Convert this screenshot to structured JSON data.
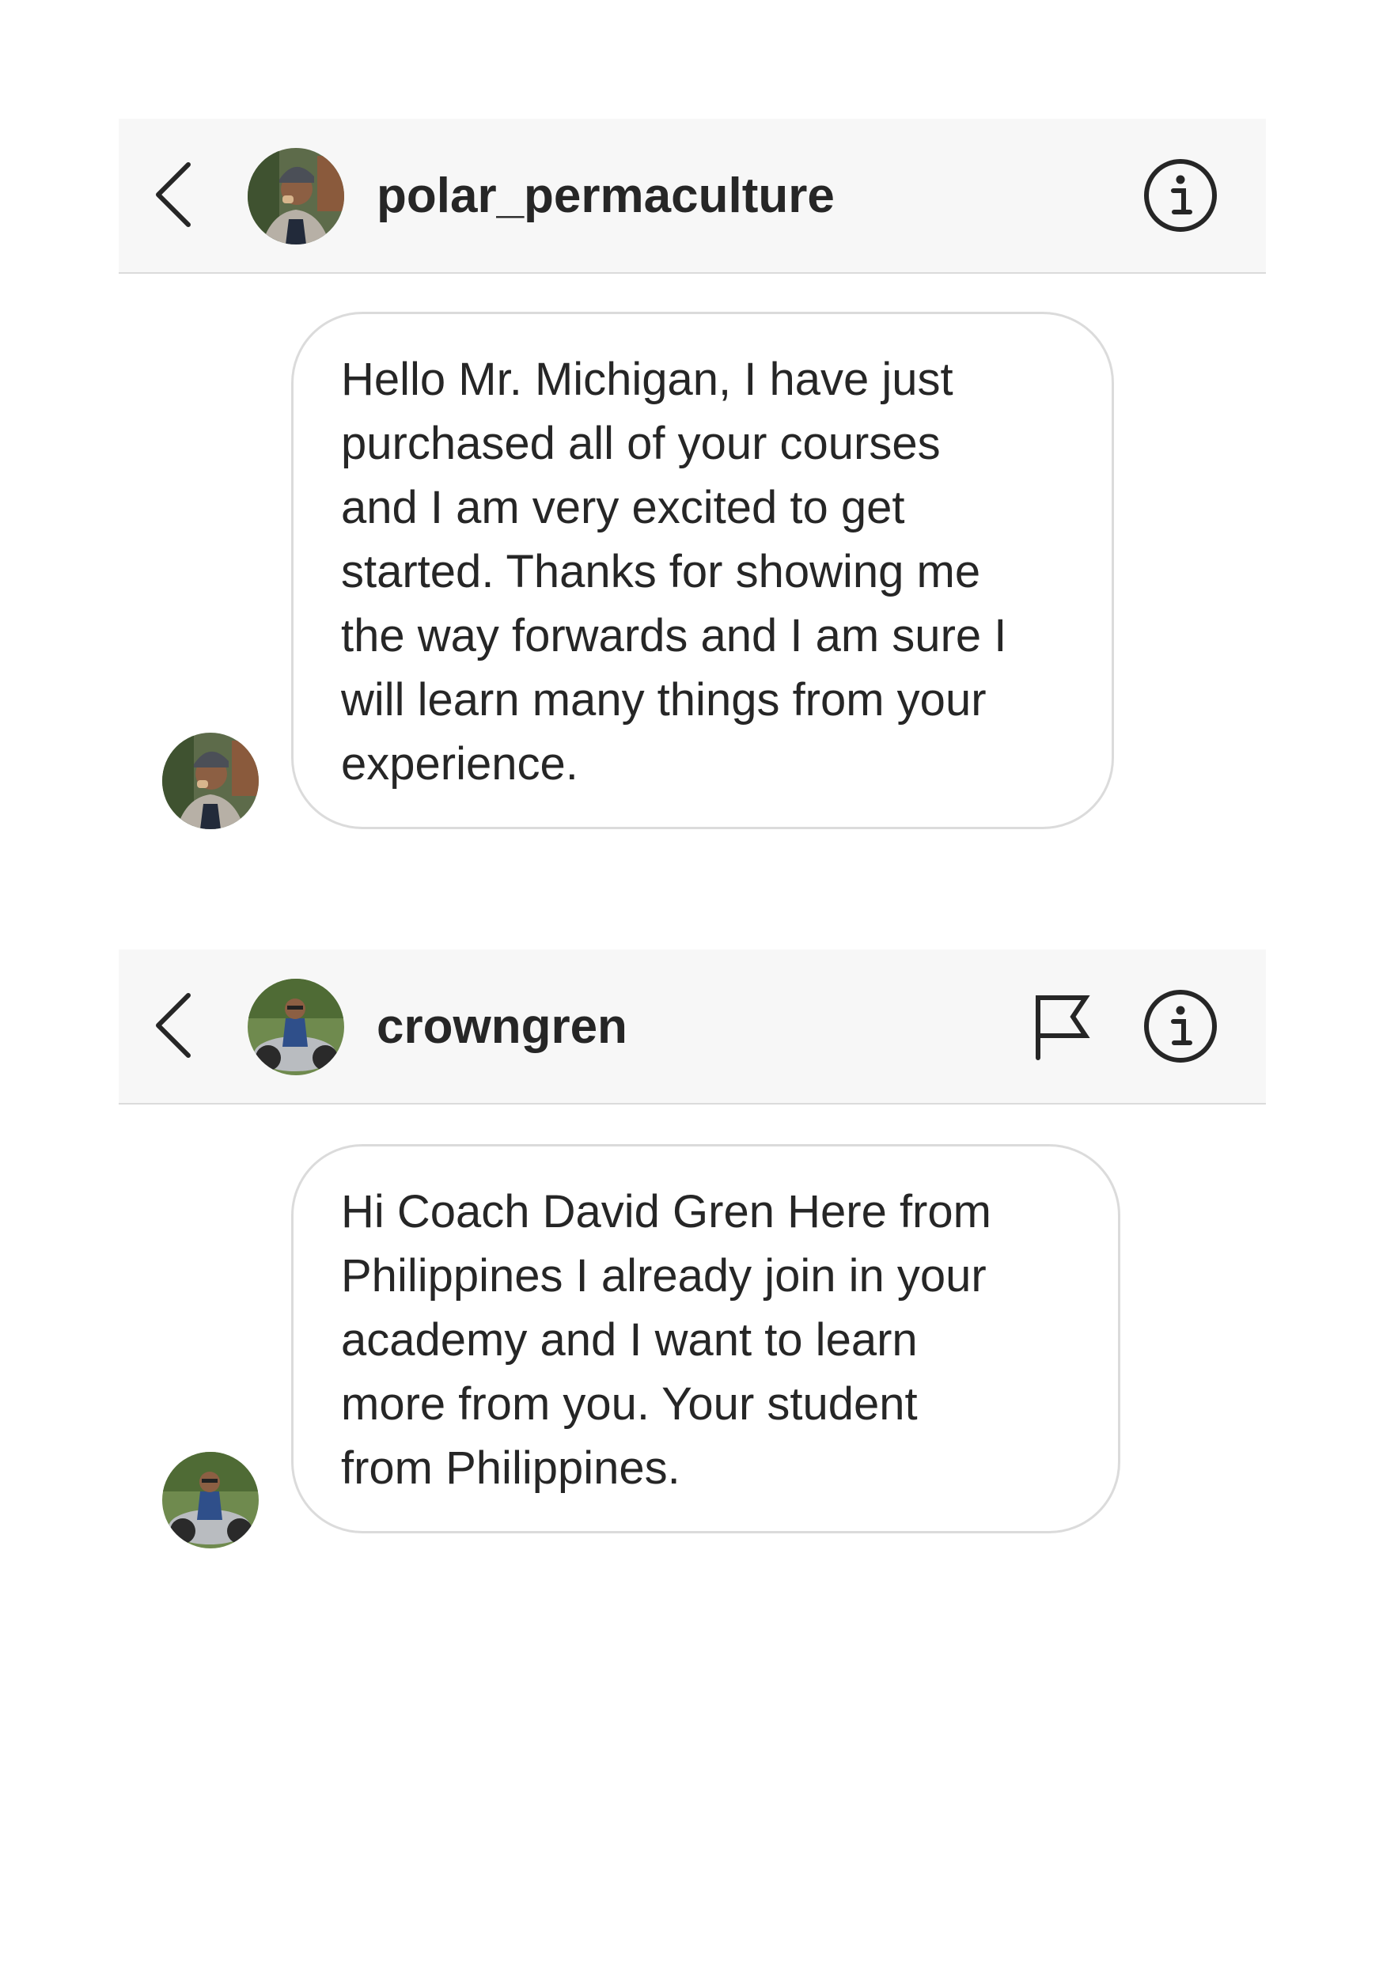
{
  "conversations": [
    {
      "header": {
        "username": "polar_permaculture",
        "avatar_icon": "user-avatar-icon",
        "back_icon": "chevron-left-icon",
        "info_icon": "info-circle-icon"
      },
      "message": {
        "text": "Hello Mr. Michigan, I have just\npurchased all of your courses\nand I am very excited to get\nstarted. Thanks for showing me\nthe way forwards and I am sure I\nwill learn many things from your\nexperience."
      }
    },
    {
      "header": {
        "username": "crowngren",
        "avatar_icon": "user-avatar-icon",
        "back_icon": "chevron-left-icon",
        "flag_icon": "flag-icon",
        "info_icon": "info-circle-icon"
      },
      "message": {
        "text": "Hi Coach David  Gren Here from\nPhilippines  I already  join in your\nacademy  and I want to learn\nmore from you. Your student\nfrom Philippines."
      }
    }
  ],
  "colors": {
    "header_bg": "#f7f7f7",
    "border": "#dbdbdb",
    "text": "#262626"
  }
}
